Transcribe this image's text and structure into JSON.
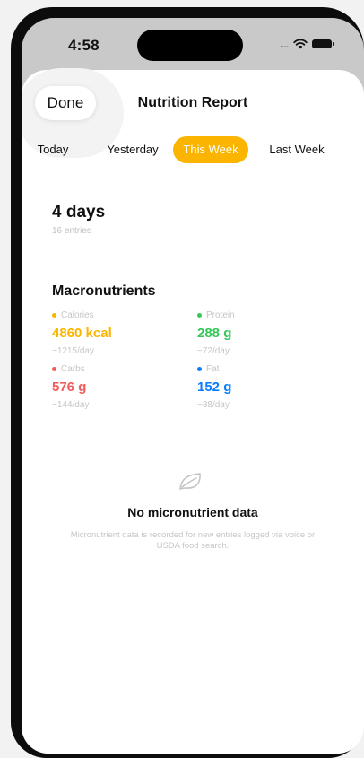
{
  "status_bar": {
    "time": "4:58",
    "signal": "....",
    "wifi_icon": "wifi-icon",
    "battery_icon": "battery-icon"
  },
  "sheet": {
    "done_label": "Done",
    "title": "Nutrition Report"
  },
  "tabs": [
    {
      "label": "Today",
      "active": false
    },
    {
      "label": "Yesterday",
      "active": false
    },
    {
      "label": "This Week",
      "active": true
    },
    {
      "label": "Last Week",
      "active": false
    }
  ],
  "summary": {
    "days": "4 days",
    "entries": "16 entries"
  },
  "macros": {
    "title": "Macronutrients",
    "items": [
      {
        "label": "Calories",
        "value": "4860 kcal",
        "per_day": "~1215/day",
        "color": "#fbb500"
      },
      {
        "label": "Protein",
        "value": "288 g",
        "per_day": "~72/day",
        "color": "#34c759"
      },
      {
        "label": "Carbs",
        "value": "576 g",
        "per_day": "~144/day",
        "color": "#ef5d5d"
      },
      {
        "label": "Fat",
        "value": "152 g",
        "per_day": "~38/day",
        "color": "#0a7cff"
      }
    ]
  },
  "empty_state": {
    "icon": "leaf-icon",
    "title": "No micronutrient data",
    "description": "Micronutrient data is recorded for new entries logged via voice or USDA food search."
  },
  "colors": {
    "accent": "#fbb500",
    "sheet_bg": "#ffffff",
    "frame": "#0c0c0c"
  }
}
